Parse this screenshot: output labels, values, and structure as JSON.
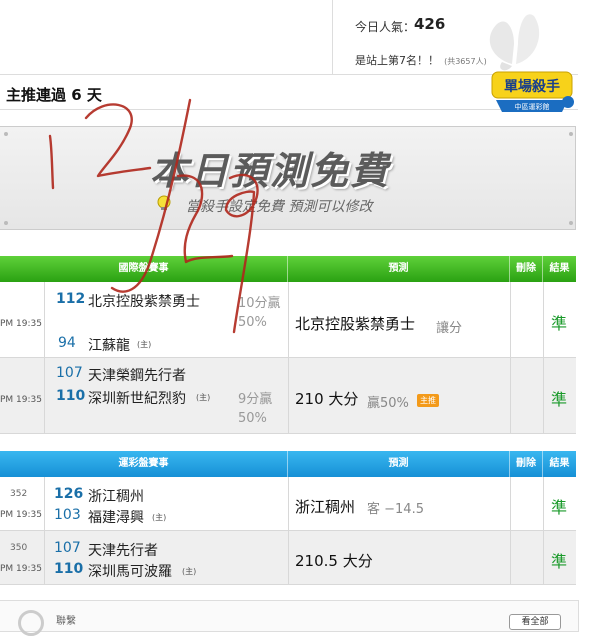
{
  "stats": {
    "popularity_label": "今日人氣：",
    "popularity_value": "426",
    "rank_text": "是站上第7名！！",
    "rank_total": "(共3657人)"
  },
  "push": {
    "text": "主推連過 6 天"
  },
  "badge": {
    "line1": "單場殺手",
    "line2": "中區運彩館"
  },
  "banner": {
    "title": "本日預測免費",
    "subtitle": "當殺手設定免費  預測可以修改"
  },
  "international": {
    "headers": {
      "match": "國際盤賽事",
      "prediction": "預測",
      "delete": "刪除",
      "result": "結果"
    },
    "rows": [
      {
        "time": "PM 19:35",
        "team1_num": "112",
        "team1_name": "北京控股紫禁勇士",
        "team1_host": "",
        "team2_num": "94",
        "team2_name": "江蘇龍",
        "team2_host": "(主)",
        "handicap1": "10分贏",
        "handicap2": "50%",
        "pred_main": "北京控股紫禁勇士",
        "pred_sub": "讓分",
        "pred_tag": "",
        "result": "準"
      },
      {
        "time": "PM 19:35",
        "team1_num": "107",
        "team1_name": "天津榮鋼先行者",
        "team1_host": "",
        "team2_num": "110",
        "team2_name": "深圳新世紀烈豹",
        "team2_host": "(主)",
        "handicap1": "9分贏",
        "handicap2": "50%",
        "pred_main": "210 大分",
        "pred_sub": "贏50%",
        "pred_tag": "主推",
        "result": "準"
      }
    ]
  },
  "sports_lottery": {
    "headers": {
      "match": "運彩盤賽事",
      "prediction": "預測",
      "delete": "刪除",
      "result": "結果"
    },
    "rows": [
      {
        "num": "352",
        "time": "PM 19:35",
        "team1_num": "126",
        "team1_name": "浙江稠州",
        "team2_num": "103",
        "team2_name": "福建潯興",
        "team2_host": "(主)",
        "pred_main": "浙江稠州",
        "pred_sub": "客 −14.5",
        "result": "準"
      },
      {
        "num": "350",
        "time": "PM 19:35",
        "team1_num": "107",
        "team1_name": "天津先行者",
        "team2_num": "110",
        "team2_name": "深圳馬可波羅",
        "team2_host": "(主)",
        "pred_main": "210.5 大分",
        "pred_sub": "",
        "result": "準"
      }
    ]
  },
  "bottom": {
    "text": "聯繫",
    "button": "看全部"
  },
  "handwriting": "12/29",
  "colors": {
    "green_header": "#2aa112",
    "blue_header": "#1690d6",
    "result_green": "#1a9a2a",
    "team_num_blue": "#1a6fa8",
    "tag_orange": "#f39a1a"
  }
}
